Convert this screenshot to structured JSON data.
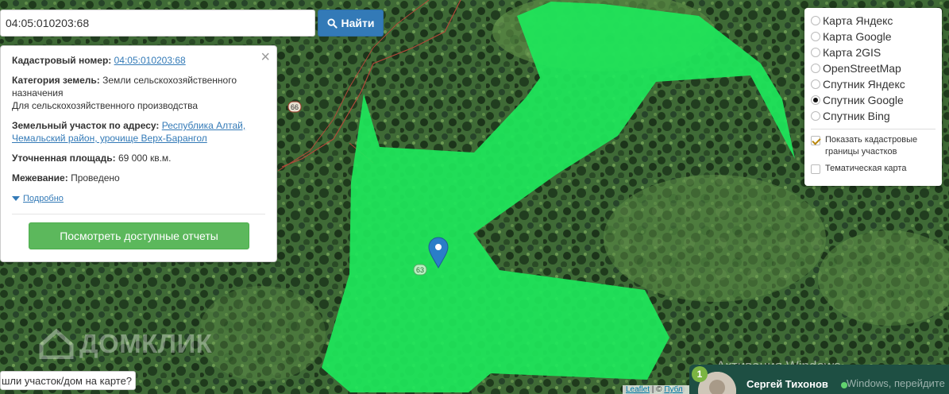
{
  "search": {
    "value": "04:05:010203:68",
    "button_label": "Найти"
  },
  "info": {
    "cadastral_label": "Кадастровый номер:",
    "cadastral_value": "04:05:010203:68",
    "category_label": "Категория земель:",
    "category_value": "Земли сельскохозяйственного назначения",
    "category_use": "Для сельскохозяйственного производства",
    "address_label": "Земельный участок по адресу:",
    "address_value": "Республика Алтай, Чемальский район, урочище Верх-Барангол",
    "area_label": "Уточненная площадь:",
    "area_value": "69 000 кв.м.",
    "survey_label": "Межевание:",
    "survey_value": "Проведено",
    "more_label": "Подробно",
    "reports_button": "Посмотреть доступные отчеты",
    "close_symbol": "×"
  },
  "layers": {
    "options": [
      "Карта Яндекс",
      "Карта Google",
      "Карта 2GIS",
      "OpenStreetMap",
      "Спутник Яндекс",
      "Спутник Google",
      "Спутник Bing"
    ],
    "selected": "Спутник Google",
    "show_boundaries_label": "Показать кадастровые границы участков",
    "show_boundaries_checked": true,
    "thematic_label": "Тематическая карта",
    "thematic_checked": false
  },
  "map": {
    "road_label_1": "66",
    "road_label_2": "63",
    "parcel_color": "#1ee65a",
    "watermark_text": "ДОМКЛИК",
    "prompt_text": "шли участок/дом на карте?",
    "attribution_leaflet": "Leaflet",
    "attribution_sep": " | © ",
    "attribution_rest": "Публ"
  },
  "windows": {
    "title": "Активация Windows",
    "subtitle": "Windows, перейдите"
  },
  "chat": {
    "badge_count": "1",
    "agent_name": "Сергей Тихонов"
  }
}
